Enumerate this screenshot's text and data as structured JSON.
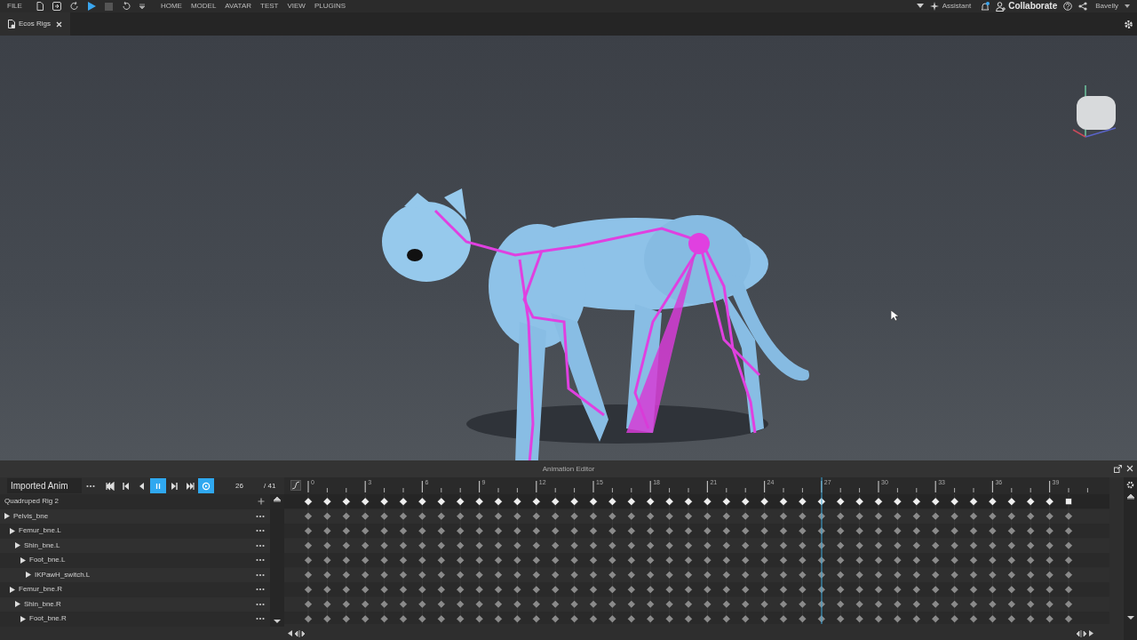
{
  "menubar": {
    "items": [
      "FILE",
      "HOME",
      "MODEL",
      "AVATAR",
      "TEST",
      "VIEW",
      "PLUGINS"
    ],
    "assistant": "Assistant",
    "collaborate": "Collaborate",
    "user": "Bavelly"
  },
  "tabs": [
    {
      "label": "Ecos Rigs",
      "selected": true
    }
  ],
  "animation_editor": {
    "title": "Animation Editor",
    "animation_name": "Imported Anim",
    "transport": [
      {
        "kind": "first",
        "on": false
      },
      {
        "kind": "prev_key",
        "on": false
      },
      {
        "kind": "reverse",
        "on": false
      },
      {
        "kind": "pause",
        "on": true
      },
      {
        "kind": "next_key",
        "on": false
      },
      {
        "kind": "last",
        "on": false
      },
      {
        "kind": "loop",
        "on": true
      }
    ],
    "current_frame": "26",
    "total_frames": "/ 41",
    "rig": "Quadruped Rig 2",
    "tracks": [
      {
        "name": "Pelvis_bne",
        "children": [
          {
            "name": "Femur_bne.L",
            "children": [
              {
                "name": "Shin_bne.L",
                "children": [
                  {
                    "name": "Foot_bne.L",
                    "children": [
                      {
                        "name": "IKPawH_switch.L"
                      }
                    ]
                  }
                ]
              }
            ]
          },
          {
            "name": "Femur_bne.R",
            "children": [
              {
                "name": "Shin_bne.R",
                "children": [
                  {
                    "name": "Foot_bne.R"
                  }
                ]
              }
            ]
          }
        ]
      }
    ],
    "ruler_labels": [
      "0",
      "3",
      "6",
      "9",
      "12",
      "15",
      "18",
      "21",
      "24",
      "27",
      "30",
      "33",
      "36",
      "39"
    ],
    "playhead": {
      "level": 0.675
    }
  }
}
